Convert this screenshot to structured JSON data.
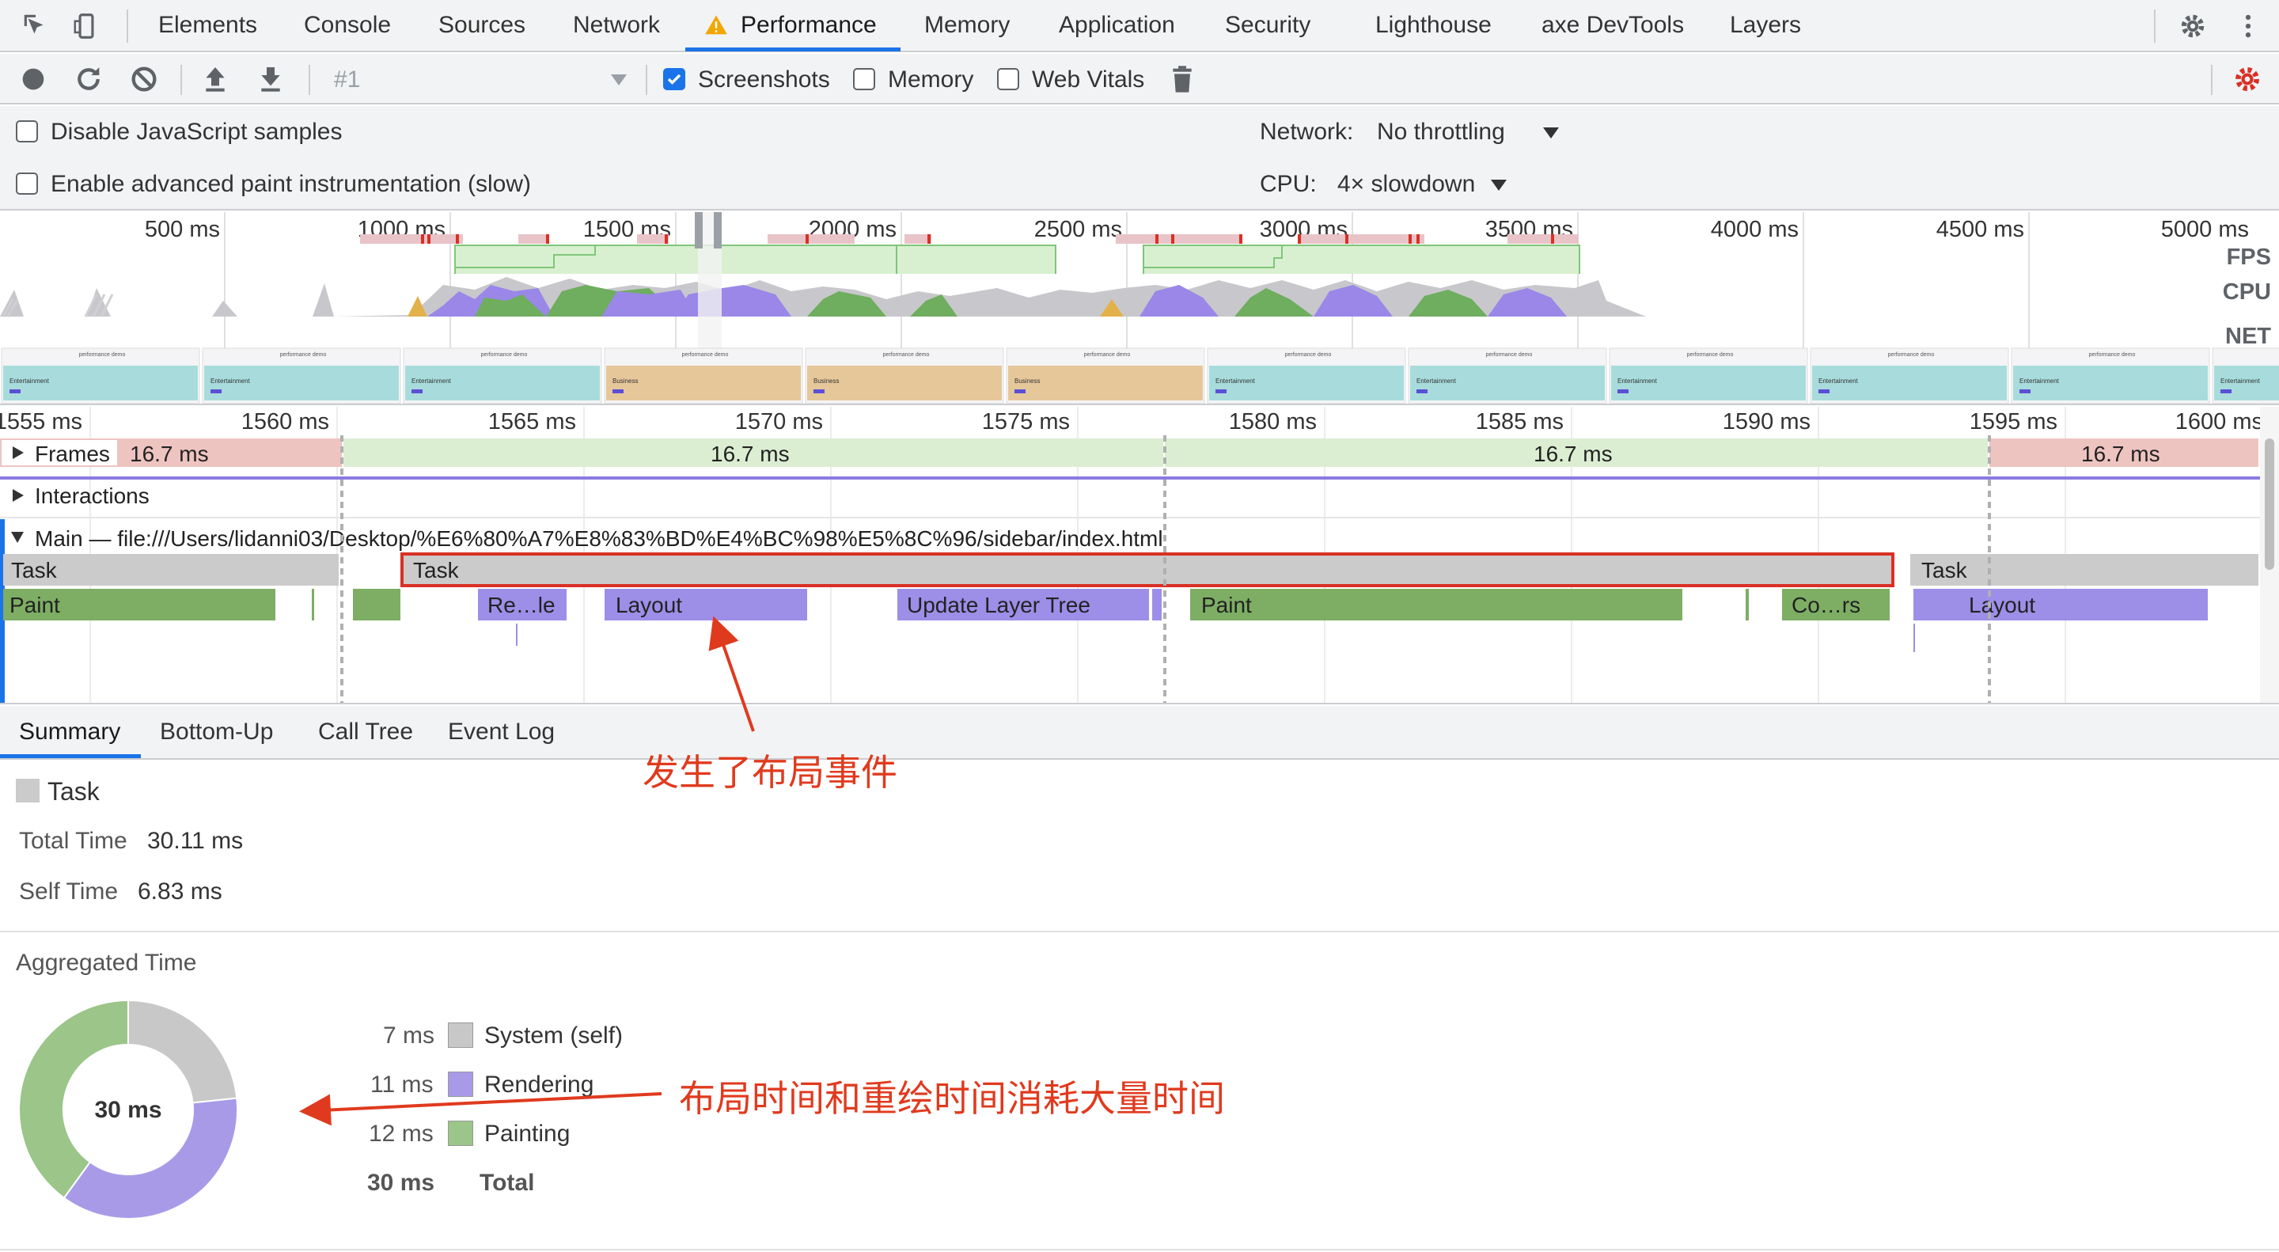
{
  "tabs": {
    "items": [
      "Elements",
      "Console",
      "Sources",
      "Network",
      "Performance",
      "Memory",
      "Application",
      "Security",
      "Lighthouse",
      "axe DevTools",
      "Layers"
    ],
    "active": "Performance"
  },
  "toolbar": {
    "profile_select": "#1",
    "screenshots_label": "Screenshots",
    "screenshots_checked": true,
    "memory_label": "Memory",
    "web_vitals_label": "Web Vitals"
  },
  "settings": {
    "disable_js_samples": "Disable JavaScript samples",
    "advanced_paint": "Enable advanced paint instrumentation (slow)",
    "network_label": "Network:",
    "network_value": "No throttling",
    "cpu_label": "CPU:",
    "cpu_value": "4× slowdown"
  },
  "overview": {
    "ticks": [
      "500 ms",
      "1000 ms",
      "1500 ms",
      "2000 ms",
      "2500 ms",
      "3000 ms",
      "3500 ms",
      "4000 ms",
      "4500 ms",
      "5000 ms"
    ],
    "row_labels": [
      "FPS",
      "CPU",
      "NET"
    ],
    "screenshot_title": "performance demo",
    "screenshot_texts": [
      "Entertainment",
      "Entertainment",
      "Entertainment",
      "Business",
      "Business",
      "Business",
      "Entertainment",
      "Entertainment",
      "Entertainment",
      "Entertainment",
      "Entertainment",
      "Entertainment"
    ]
  },
  "flame": {
    "ticks": [
      "1555 ms",
      "1560 ms",
      "1565 ms",
      "1570 ms",
      "1575 ms",
      "1580 ms",
      "1585 ms",
      "1590 ms",
      "1595 ms",
      "1600 ms"
    ],
    "frames_label": "Frames",
    "frame_values": [
      "16.7 ms",
      "16.7 ms",
      "16.7 ms",
      "16.7 ms"
    ],
    "interactions_label": "Interactions",
    "main_label": "Main — file:///Users/lidanni03/Desktop/%E6%80%A7%E8%83%BD%E4%BC%98%E5%8C%96/sidebar/index.html",
    "tasks": [
      "Task",
      "Task",
      "Task"
    ],
    "events": [
      "Paint",
      "Re…le",
      "Layout",
      "Update Layer Tree",
      "Paint",
      "Co…rs",
      "Layout"
    ]
  },
  "bottom_tabs": {
    "items": [
      "Summary",
      "Bottom-Up",
      "Call Tree",
      "Event Log"
    ],
    "active": "Summary"
  },
  "summary": {
    "title": "Task",
    "total_time_label": "Total Time",
    "total_time_value": "30.11 ms",
    "self_time_label": "Self Time",
    "self_time_value": "6.83 ms",
    "aggregated_title": "Aggregated Time",
    "donut_center": "30 ms",
    "legend": [
      {
        "value": "7 ms",
        "label": "System (self)",
        "color": "#c8c8c8",
        "ms": 7
      },
      {
        "value": "11 ms",
        "label": "Rendering",
        "color": "#a99ae8",
        "ms": 11
      },
      {
        "value": "12 ms",
        "label": "Painting",
        "color": "#9bc589",
        "ms": 12
      }
    ],
    "total_value": "30 ms",
    "total_label": "Total"
  },
  "annotations": {
    "layout_event": "发生了布局事件",
    "time_consumed": "布局时间和重绘时间消耗大量时间"
  },
  "colors": {
    "accent": "#1a73e8",
    "annotation": "#e03a1e",
    "rendering": "#a99ae8",
    "painting": "#9bc589",
    "system": "#c8c8c8",
    "frame_dropped": "#eec4c0",
    "frame_ok": "#dbeed2"
  }
}
